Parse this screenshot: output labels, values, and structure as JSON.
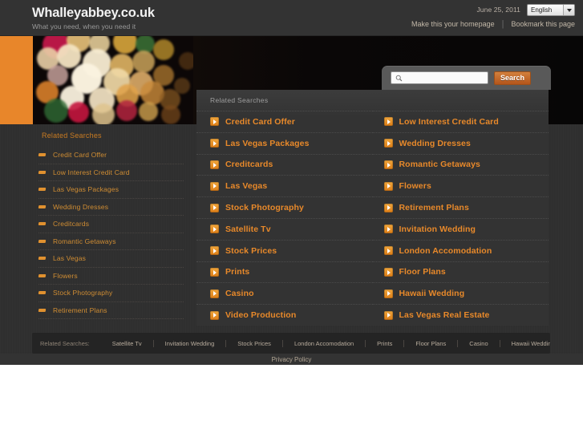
{
  "header": {
    "site_title": "Whalleyabbey.co.uk",
    "tagline": "What you need, when you need it",
    "date": "June 25, 2011",
    "language": "English",
    "homepage_link": "Make this your homepage",
    "bookmark_link": "Bookmark this page"
  },
  "search": {
    "value": "",
    "placeholder": "",
    "button_label": "Search"
  },
  "sidebar": {
    "heading": "Related Searches",
    "items": [
      {
        "label": "Credit Card Offer"
      },
      {
        "label": "Low Interest Credit Card"
      },
      {
        "label": "Las Vegas Packages"
      },
      {
        "label": "Wedding Dresses"
      },
      {
        "label": "Creditcards"
      },
      {
        "label": "Romantic Getaways"
      },
      {
        "label": "Las Vegas"
      },
      {
        "label": "Flowers"
      },
      {
        "label": "Stock Photography"
      },
      {
        "label": "Retirement Plans"
      }
    ]
  },
  "main": {
    "heading": "Related Searches",
    "items": [
      {
        "label": "Credit Card Offer"
      },
      {
        "label": "Low Interest Credit Card"
      },
      {
        "label": "Las Vegas Packages"
      },
      {
        "label": "Wedding Dresses"
      },
      {
        "label": "Creditcards"
      },
      {
        "label": "Romantic Getaways"
      },
      {
        "label": "Las Vegas"
      },
      {
        "label": "Flowers"
      },
      {
        "label": "Stock Photography"
      },
      {
        "label": "Retirement Plans"
      },
      {
        "label": "Satellite Tv"
      },
      {
        "label": "Invitation Wedding"
      },
      {
        "label": "Stock Prices"
      },
      {
        "label": "London Accomodation"
      },
      {
        "label": "Prints"
      },
      {
        "label": "Floor Plans"
      },
      {
        "label": "Casino"
      },
      {
        "label": "Hawaii Wedding"
      },
      {
        "label": "Video Production"
      },
      {
        "label": "Las Vegas Real Estate"
      }
    ]
  },
  "footer": {
    "label": "Related Searches:",
    "links": [
      {
        "label": "Satellite Tv"
      },
      {
        "label": "Invitation Wedding"
      },
      {
        "label": "Stock Prices"
      },
      {
        "label": "London Accomodation"
      },
      {
        "label": "Prints"
      },
      {
        "label": "Floor Plans"
      },
      {
        "label": "Casino"
      },
      {
        "label": "Hawaii Wedding"
      }
    ],
    "privacy_label": "Privacy Policy"
  },
  "colors": {
    "accent_orange": "#e8892a",
    "hero_block": "#e8862a",
    "panel_bg": "#333333",
    "page_bg": "#2e2e2e",
    "link_muted": "#b8ac9d"
  }
}
